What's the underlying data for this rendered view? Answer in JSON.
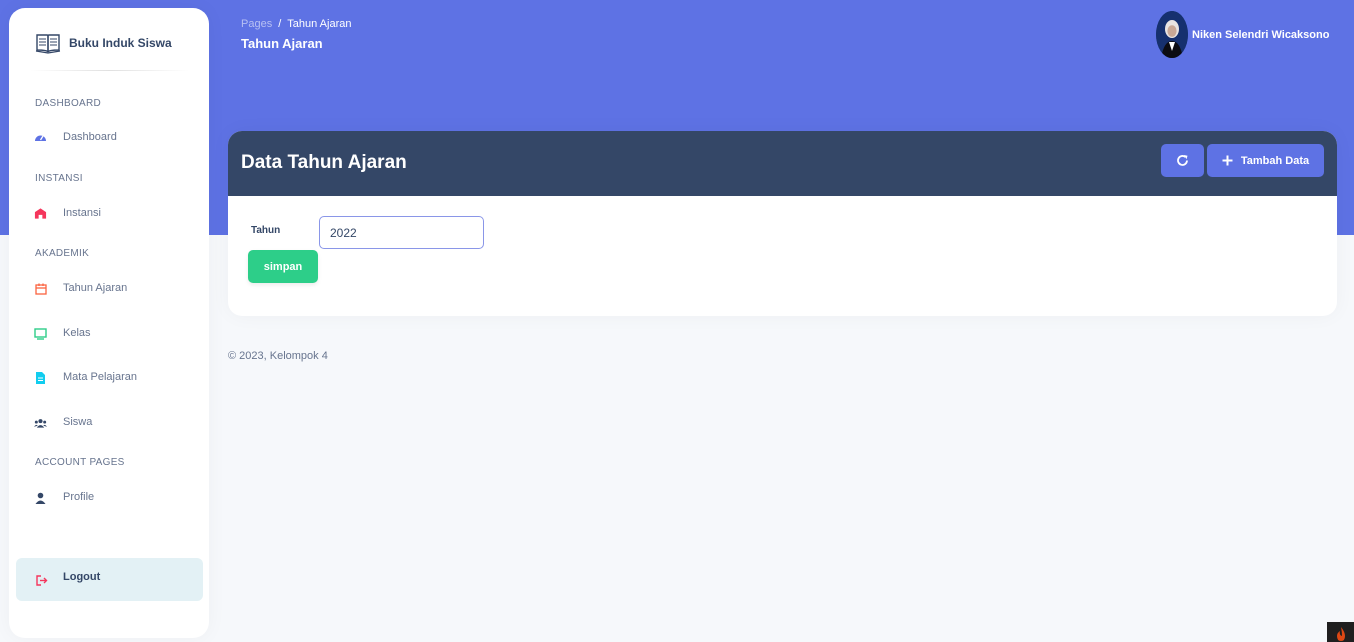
{
  "brand": {
    "name": "Buku Induk Siswa",
    "icon": "book-icon"
  },
  "sidebar": {
    "sections": [
      {
        "title": "DASHBOARD"
      },
      {
        "title": "INSTANSI"
      },
      {
        "title": "AKADEMIK"
      },
      {
        "title": "ACCOUNT PAGES"
      }
    ],
    "items": [
      {
        "label": "Dashboard",
        "icon": "speedometer-icon",
        "color": "#5e72e4"
      },
      {
        "label": "Instansi",
        "icon": "building-icon",
        "color": "#f5365c"
      },
      {
        "label": "Tahun Ajaran",
        "icon": "calendar-icon",
        "color": "#fb6340"
      },
      {
        "label": "Kelas",
        "icon": "monitor-icon",
        "color": "#2dce89"
      },
      {
        "label": "Mata Pelajaran",
        "icon": "document-icon",
        "color": "#11cdef"
      },
      {
        "label": "Siswa",
        "icon": "users-icon",
        "color": "#344767"
      },
      {
        "label": "Profile",
        "icon": "user-icon",
        "color": "#344767"
      }
    ],
    "logout": {
      "label": "Logout",
      "icon": "logout-icon",
      "color": "#f5365c"
    }
  },
  "header": {
    "breadcrumb": {
      "parent": "Pages",
      "separator": "/",
      "current": "Tahun Ajaran"
    },
    "title": "Tahun Ajaran",
    "user": {
      "name": "Niken Selendri Wicaksono"
    }
  },
  "card": {
    "title": "Data Tahun Ajaran",
    "refresh_icon": "refresh-icon",
    "add_button": {
      "label": "Tambah Data",
      "icon": "plus-icon"
    },
    "form": {
      "label": "Tahun",
      "value": "2022",
      "save_label": "simpan"
    }
  },
  "footer": {
    "text": "© 2023, Kelompok 4"
  },
  "colors": {
    "primary": "#5e72e4",
    "dark": "#344767",
    "success": "#2dce89",
    "background": "#f6f8fb"
  }
}
